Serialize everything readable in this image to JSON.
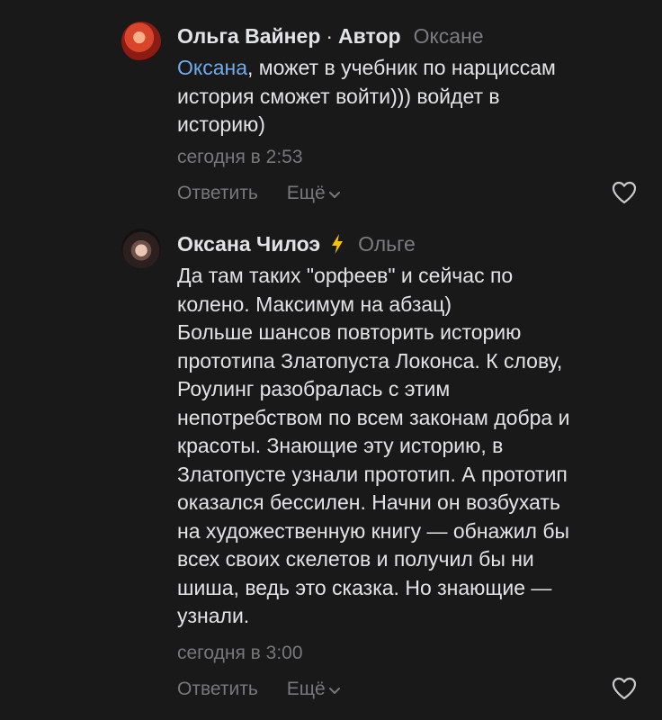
{
  "comments": [
    {
      "author": "Ольга Вайнер",
      "separator": "·",
      "badge": "Автор",
      "reply_to": "Оксане",
      "mention": "Оксана",
      "text_lines": [
        ", может в учебник по нарциссам",
        "история сможет войти))) войдет в",
        "историю)"
      ],
      "time": "сегодня в 2:53",
      "reply_label": "Ответить",
      "more_label": "Ещё",
      "avatar_icon": "avatar-photo-red-hair",
      "like_icon": "heart-outline-icon"
    },
    {
      "author": "Оксана Чилоэ",
      "verified_icon": "lightning-bolt-icon",
      "reply_to": "Ольге",
      "text_lines": [
        "Да там таких \"орфеев\" и сейчас по",
        "колено. Максимум на абзац)",
        "Больше шансов повторить историю",
        "прототипа Златопуста Локонса. К слову,",
        "Роулинг разобралась с этим",
        "непотребством по всем законам добра и",
        "красоты. Знающие эту историю, в",
        "Златопусте узнали прототип. А прототип",
        "оказался бессилен. Начни он возбухать",
        "на художественную книгу — обнажил бы",
        "всех своих скелетов и получил бы ни",
        "шиша, ведь это сказка. Но знающие —",
        "узнали."
      ],
      "time": "сегодня в 3:00",
      "reply_label": "Ответить",
      "more_label": "Ещё",
      "avatar_icon": "avatar-photo-dark-hair",
      "like_icon": "heart-outline-icon"
    }
  ],
  "colors": {
    "background": "#19191a",
    "text": "#e1e3e6",
    "secondary": "#76787a",
    "mention": "#71aaeb",
    "bolt": "#f5c400"
  }
}
